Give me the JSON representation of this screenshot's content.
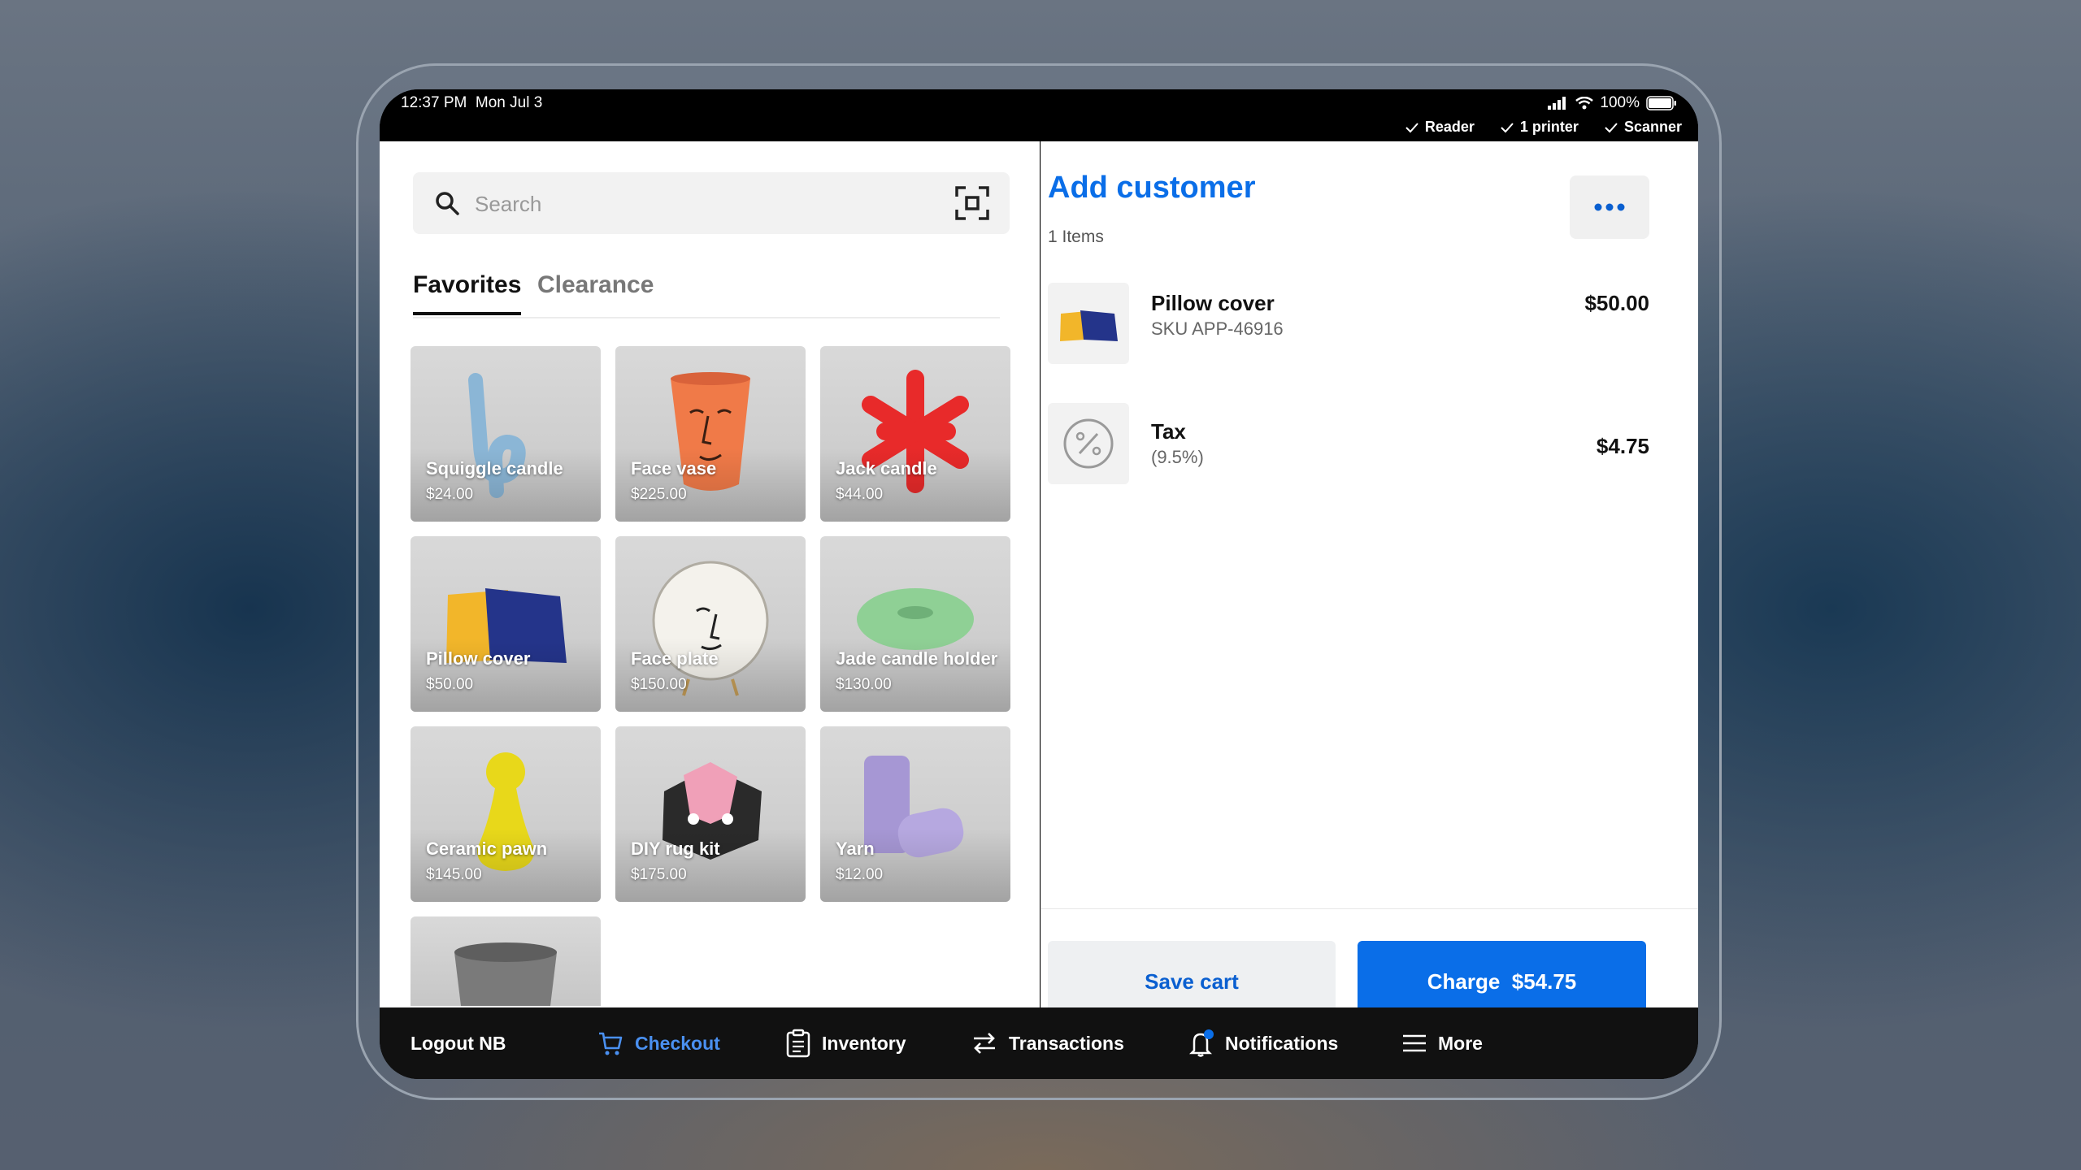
{
  "status_bar": {
    "time": "12:37 PM",
    "date": "Mon Jul 3",
    "battery": "100%",
    "devices": [
      "Reader",
      "1 printer",
      "Scanner"
    ]
  },
  "search": {
    "placeholder": "Search"
  },
  "tabs": [
    {
      "label": "Favorites",
      "active": true
    },
    {
      "label": "Clearance",
      "active": false
    }
  ],
  "products": [
    {
      "name": "Squiggle candle",
      "price": "$24.00"
    },
    {
      "name": "Face vase",
      "price": "$225.00"
    },
    {
      "name": "Jack candle",
      "price": "$44.00"
    },
    {
      "name": "Pillow cover",
      "price": "$50.00"
    },
    {
      "name": "Face plate",
      "price": "$150.00"
    },
    {
      "name": "Jade candle holder",
      "price": "$130.00"
    },
    {
      "name": "Ceramic pawn",
      "price": "$145.00"
    },
    {
      "name": "DIY rug kit",
      "price": "$175.00"
    },
    {
      "name": "Yarn",
      "price": "$12.00"
    },
    {
      "name": "",
      "price": ""
    }
  ],
  "cart": {
    "title": "Add customer",
    "items_count": "1 Items",
    "lines": [
      {
        "name": "Pillow cover",
        "sub": "SKU APP-46916",
        "price": "$50.00"
      },
      {
        "name": "Tax",
        "sub": "(9.5%)",
        "price": "$4.75"
      }
    ],
    "save_label": "Save cart",
    "charge_label": "Charge  $54.75"
  },
  "nav": {
    "logout": "Logout NB",
    "checkout": "Checkout",
    "inventory": "Inventory",
    "transactions": "Transactions",
    "notifications": "Notifications",
    "more": "More"
  },
  "colors": {
    "accent": "#0a6ee8",
    "nav_bg": "#111111"
  }
}
